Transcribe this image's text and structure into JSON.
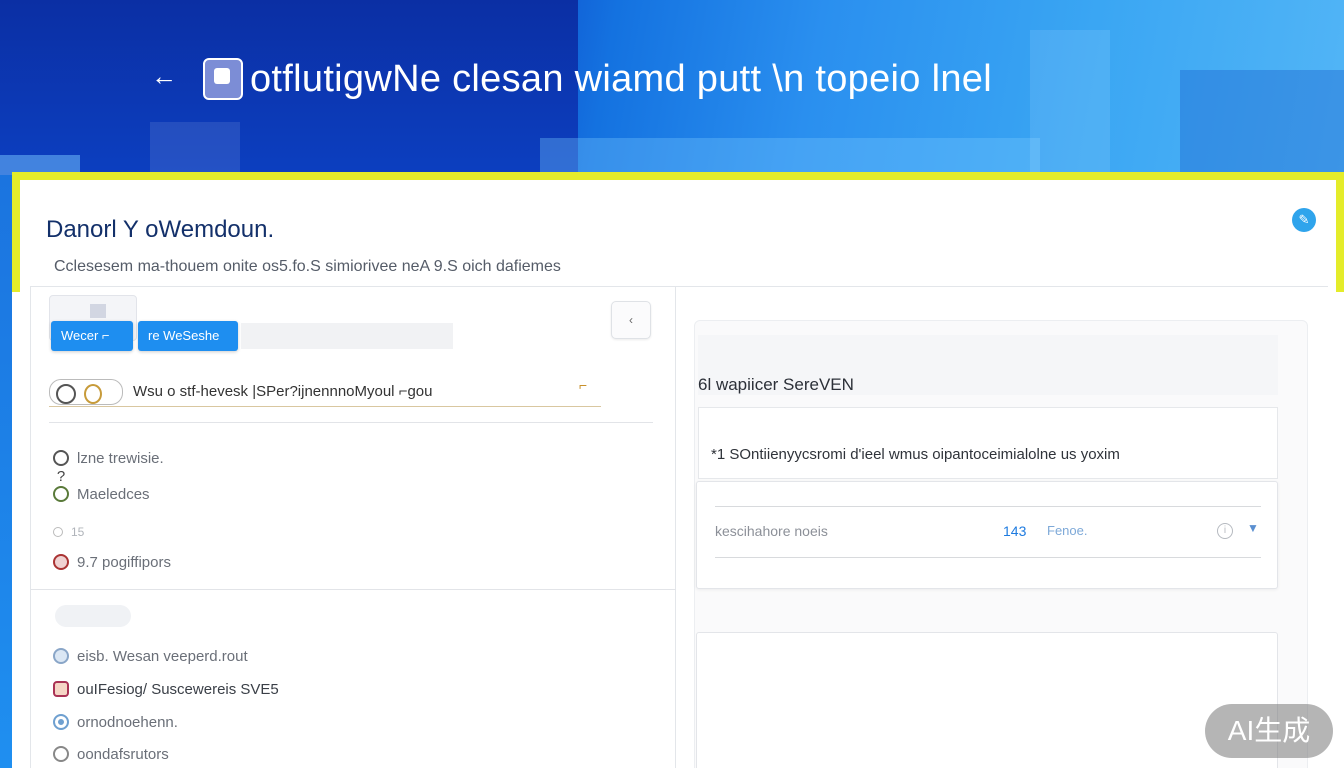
{
  "banner": {
    "back_glyph": "←",
    "title": "otflutigwNe clesan wiamd putt \\n topeio  lnel"
  },
  "dialog": {
    "title": "Danorl Y oWemdoun.",
    "subtitle": "Cclesesem ma-thouem onite os5.fo.S simiorivee neA 9.S oich dafiemes",
    "corner_glyph": "✎"
  },
  "left_panel": {
    "buttons": [
      {
        "label": "Wecer  ⌐"
      },
      {
        "label": "re WeSeshe"
      }
    ],
    "collapse_glyph": "‹",
    "chip_text": "Wsu   o   stf-hevesk |SPer?ijnennnoMyoul ⌐gou",
    "list_top": [
      {
        "text": "lzne trewisie."
      },
      {
        "text": ""
      },
      {
        "text": "Maeledces"
      },
      {
        "text": "15"
      },
      {
        "text": "9.7 pogiffipors"
      }
    ],
    "list_bottom": [
      {
        "text": "eisb. Wesan veeperd.rout"
      },
      {
        "text": "ouIFesiog/ Suscewereis SVE5"
      },
      {
        "text": "ornodnoehenn."
      },
      {
        "text": "oondafsrutors"
      }
    ]
  },
  "right_panel": {
    "label": "6l wapiicer SereVEN",
    "box_text": "*1 SOntiienyycsromi d'ieel wmus oipantoceimialolne us yoxim",
    "field": {
      "label": "kescihahore  noeis",
      "value": "143",
      "unit": "Fenoe."
    }
  },
  "watermark": "AI生成"
}
